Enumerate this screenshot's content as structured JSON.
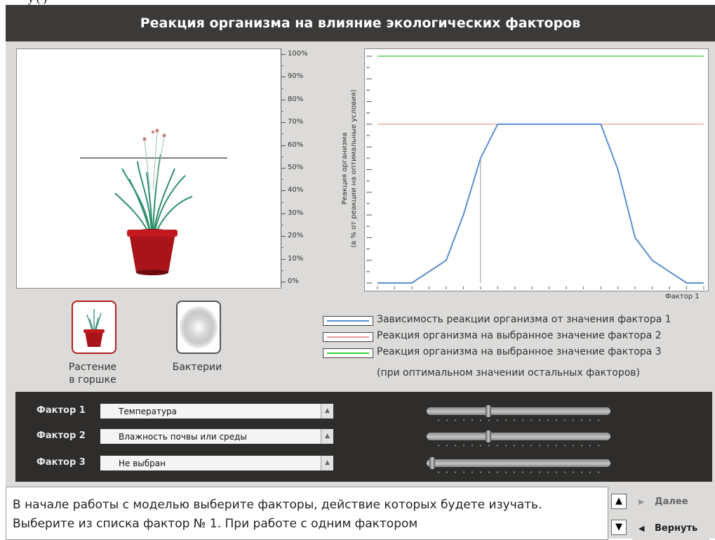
{
  "header": {
    "title": "Реакция организма на влияние экологических факторов"
  },
  "top_strip": {
    "text": "y (    )"
  },
  "plant_scale": {
    "labels": [
      "100%",
      "90%",
      "80%",
      "70%",
      "60%",
      "50%",
      "40%",
      "30%",
      "20%",
      "10%",
      "0%"
    ],
    "indicator_level_percent": 56
  },
  "chart_data": {
    "type": "line",
    "ylabel": "Реакция организма\n(в % от реакции на оптимальные условия)",
    "xlabel": "Фактор 1",
    "ylim": [
      0,
      100
    ],
    "x_ticks": 20,
    "series": [
      {
        "name": "Зависимость реакции организма от значения фактора 1",
        "color": "#5b8fd0",
        "x": [
          0,
          2,
          4,
          5,
          6,
          7,
          13,
          14,
          15,
          16,
          18,
          19
        ],
        "y": [
          0,
          0,
          10,
          30,
          55,
          70,
          70,
          50,
          20,
          10,
          0,
          0
        ]
      },
      {
        "name": "Реакция организма на выбранное значение фактора 2",
        "color": "#ef9a9a",
        "x": [
          0,
          19
        ],
        "y": [
          70,
          70
        ]
      },
      {
        "name": "Реакция организма на выбранное значение фактора 3",
        "color": "#33cc33",
        "x": [
          0,
          19
        ],
        "y": [
          100,
          100
        ]
      }
    ],
    "marker_x": 6
  },
  "organisms": [
    {
      "label_line1": "Растение",
      "label_line2": "в горшке",
      "icon": "potted-plant-icon",
      "selected": true
    },
    {
      "label_line1": "Бактерии",
      "label_line2": "",
      "icon": "bacteria-icon",
      "selected": false
    }
  ],
  "legend": {
    "items": [
      {
        "text": "Зависимость реакции организма от значения фактора 1",
        "color": "#5b8fd0"
      },
      {
        "text": "Реакция организма на выбранное значение фактора 2",
        "color": "#ef9a9a"
      },
      {
        "text": "Реакция организма на выбранное значение фактора 3",
        "color": "#33cc33"
      }
    ],
    "subtext": "(при оптимальном значении остальных факторов)"
  },
  "factors": [
    {
      "label": "Фактор 1",
      "value": "Температура",
      "slider_fraction": 0.32
    },
    {
      "label": "Фактор 2",
      "value": "Влажность почвы или среды",
      "slider_fraction": 0.32
    },
    {
      "label": "Фактор 3",
      "value": "Не выбран",
      "slider_fraction": 0.0
    }
  ],
  "instructions": {
    "text": "В начале работы с моделью выберите факторы, действие которых будете изучать. Выберите из списка фактор № 1. При работе с одним фактором"
  },
  "nav": {
    "next_label": "Далее",
    "back_label": "Вернуть"
  },
  "colors": {
    "header_bg": "#3c3a38",
    "panel_bg": "#dcdbd9",
    "pot": "#a8141a",
    "plant": "#2f8f6a"
  }
}
